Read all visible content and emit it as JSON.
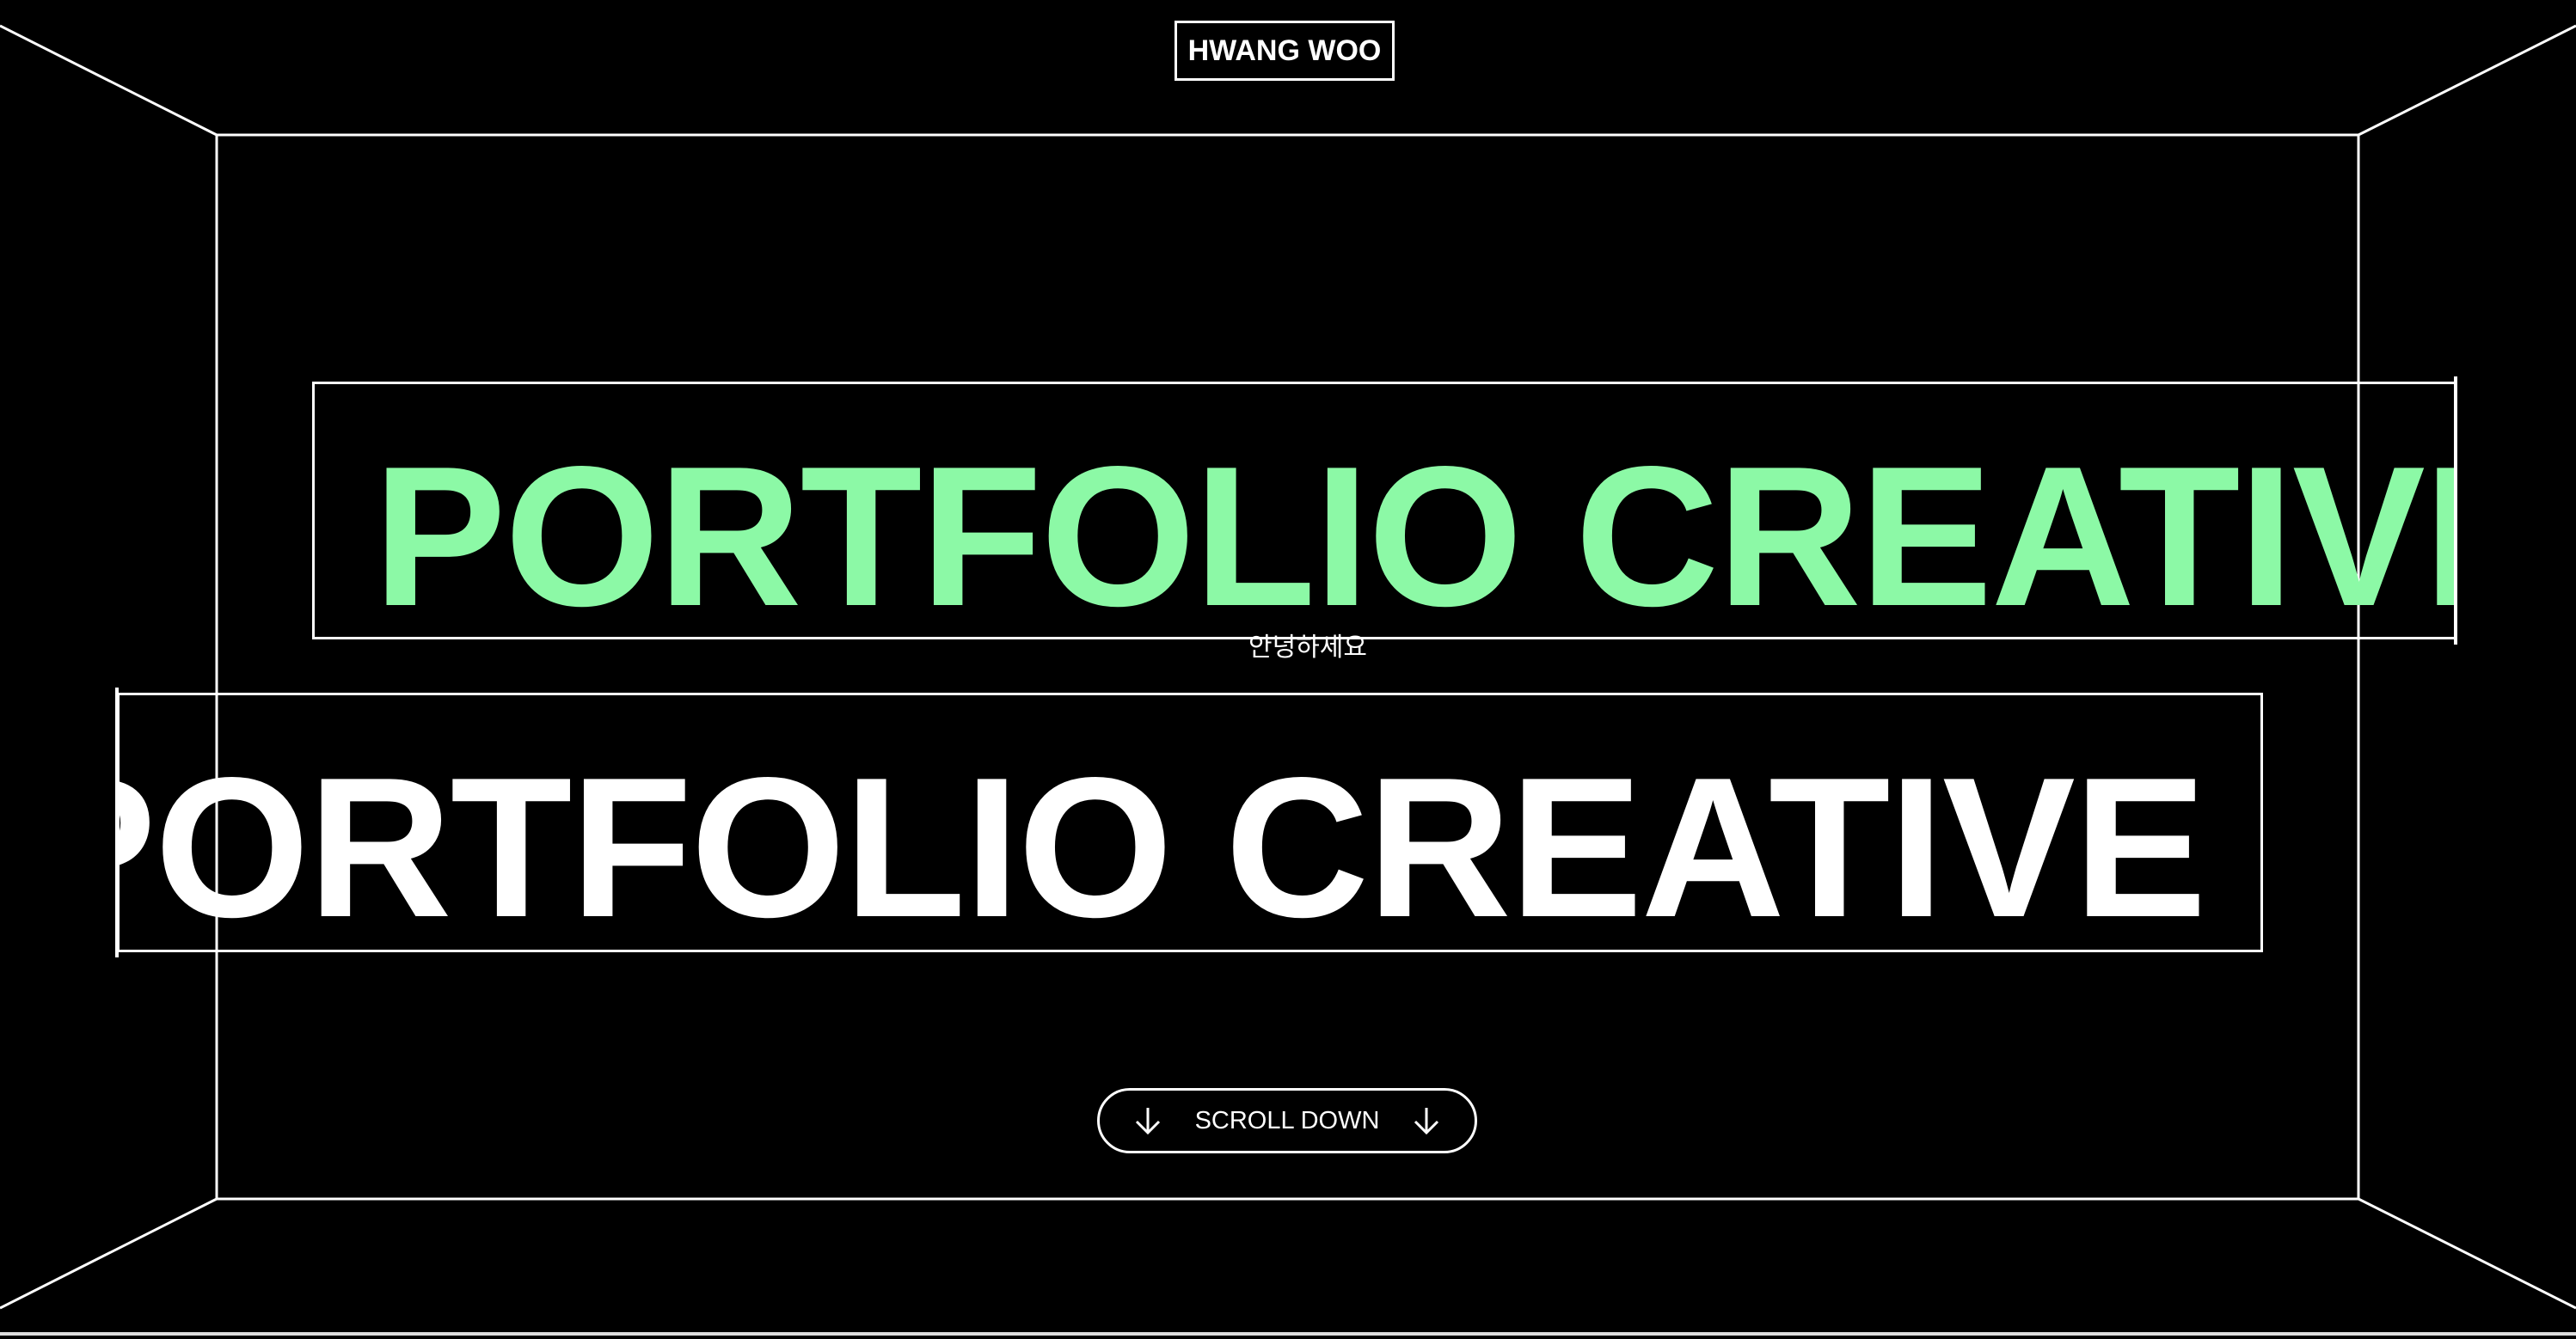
{
  "brand": {
    "logo_text": "HWANG WOO"
  },
  "hero": {
    "marquee_top_text": "PORTFOLIO CREATIVE",
    "marquee_bottom_text": "PORTFOLIO CREATIVE",
    "greeting_text": "안녕하세요"
  },
  "scroll": {
    "label": "SCROLL DOWN",
    "left_icon": "arrow-down-icon",
    "right_icon": "arrow-down-icon"
  },
  "colors": {
    "background": "#000000",
    "frame": "#ffffff",
    "accent_green": "#8cf9a6",
    "text_white": "#ffffff"
  }
}
